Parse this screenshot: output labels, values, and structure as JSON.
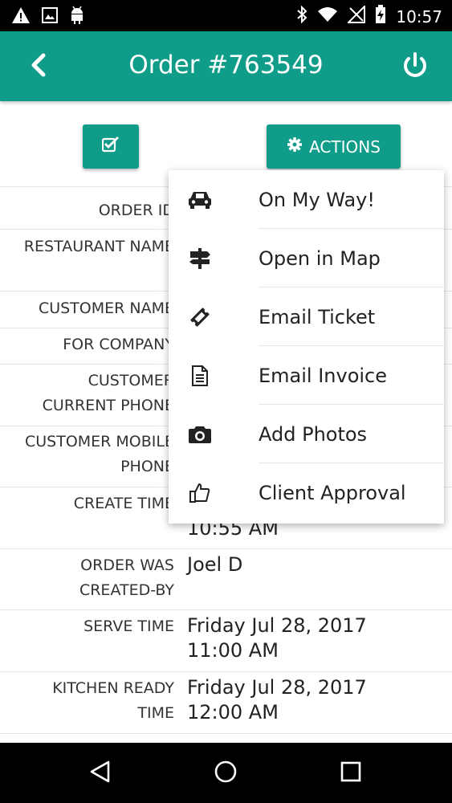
{
  "status_bar": {
    "time": "10:57",
    "left_icons": [
      "warning-icon",
      "image-icon",
      "android-icon"
    ],
    "right_icons": [
      "bluetooth-icon",
      "wifi-icon",
      "signal-icon",
      "battery-charging-icon"
    ]
  },
  "app_bar": {
    "title": "Order #763549",
    "back_icon": "chevron-left-icon",
    "power_icon": "power-icon",
    "color": "#0f9d8a"
  },
  "toolbar": {
    "check_icon": "checkbox-icon",
    "actions_label": "ACTIONS",
    "actions_icon": "gear-icon"
  },
  "details": [
    {
      "label": [
        "ORDER ID"
      ],
      "value": []
    },
    {
      "label": [
        "RESTAURANT NAME"
      ],
      "value": []
    },
    {
      "label": [
        "CUSTOMER NAME"
      ],
      "value": []
    },
    {
      "label": [
        "FOR COMPANY"
      ],
      "value": []
    },
    {
      "label": [
        "CUSTOMER",
        "CURRENT PHONE"
      ],
      "value": []
    },
    {
      "label": [
        "CUSTOMER MOBILE",
        "PHONE"
      ],
      "value": []
    },
    {
      "label": [
        "CREATE TIME"
      ],
      "value": [
        "",
        "10:55 AM"
      ]
    },
    {
      "label": [
        "ORDER WAS",
        "CREATED-BY"
      ],
      "value": [
        "Joel D"
      ]
    },
    {
      "label": [
        "SERVE TIME"
      ],
      "value": [
        "Friday Jul 28, 2017",
        "11:00 AM"
      ]
    },
    {
      "label": [
        "KITCHEN READY",
        "TIME"
      ],
      "value": [
        "Friday Jul 28, 2017",
        "12:00 AM"
      ]
    }
  ],
  "menu": {
    "items": [
      {
        "label": "On My Way!",
        "icon": "car-icon"
      },
      {
        "label": "Open in Map",
        "icon": "signpost-icon"
      },
      {
        "label": "Email Ticket",
        "icon": "ticket-icon"
      },
      {
        "label": "Email Invoice",
        "icon": "document-icon"
      },
      {
        "label": "Add Photos",
        "icon": "camera-icon"
      },
      {
        "label": "Client Approval",
        "icon": "thumbs-up-icon"
      }
    ]
  },
  "nav_bar": {
    "icons": [
      "back-triangle-icon",
      "home-circle-icon",
      "recents-square-icon"
    ]
  }
}
